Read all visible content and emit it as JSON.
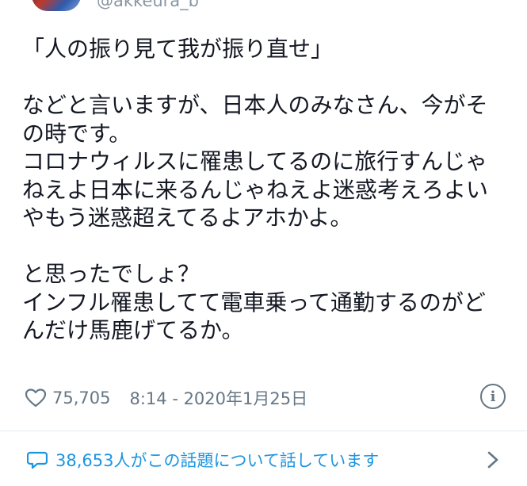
{
  "author": {
    "handle": "@akkeura_b",
    "avatar_icon": "avatar-image"
  },
  "tweet": {
    "lines": [
      "「人の振り見て我が振り直せ」",
      "",
      "などと言いますが、日本人のみなさん、今がそ",
      "の時です。",
      "コロナウィルスに罹患してるのに旅行すんじゃ",
      "ねえよ日本に来るんじゃねえよ迷惑考えろよい",
      "やもう迷惑超えてるよアホかよ。",
      "",
      "と思ったでしょ？",
      "インフル罹患してて電車乗って通勤するのがど",
      "んだけ馬鹿げてるか。"
    ]
  },
  "meta": {
    "likes": "75,705",
    "timestamp": "8:14 - 2020年1月25日",
    "info_icon": "info-icon",
    "info_glyph": "i",
    "heart_icon": "heart-icon"
  },
  "conversation": {
    "text": "38,653人がこの話題について話しています",
    "icon": "comment-icon",
    "chevron_icon": "chevron-right-icon"
  },
  "colors": {
    "text": "#141823",
    "secondary": "#657786",
    "link": "#1b95e0",
    "divider": "#e6ecf0"
  }
}
